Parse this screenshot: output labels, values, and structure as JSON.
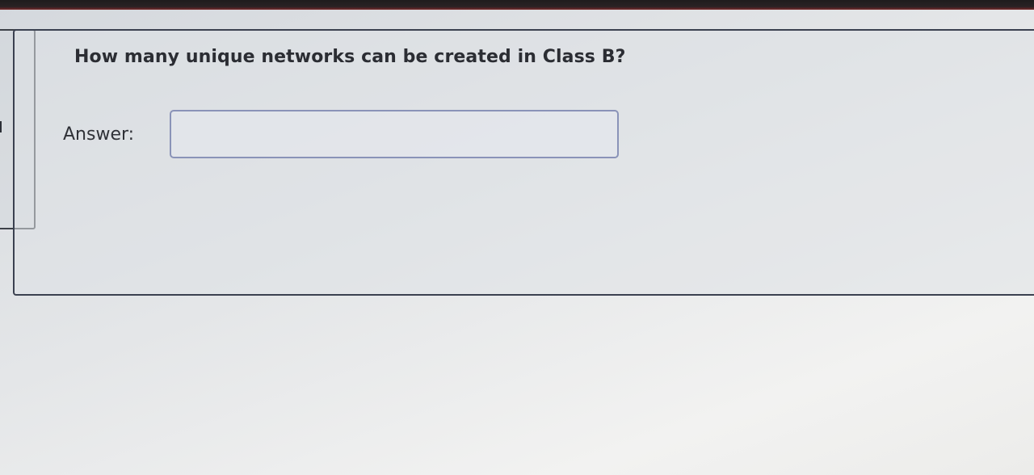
{
  "question": {
    "text": "How many unique networks can be created in Class B?"
  },
  "answer": {
    "label": "Answer:",
    "value": ""
  }
}
